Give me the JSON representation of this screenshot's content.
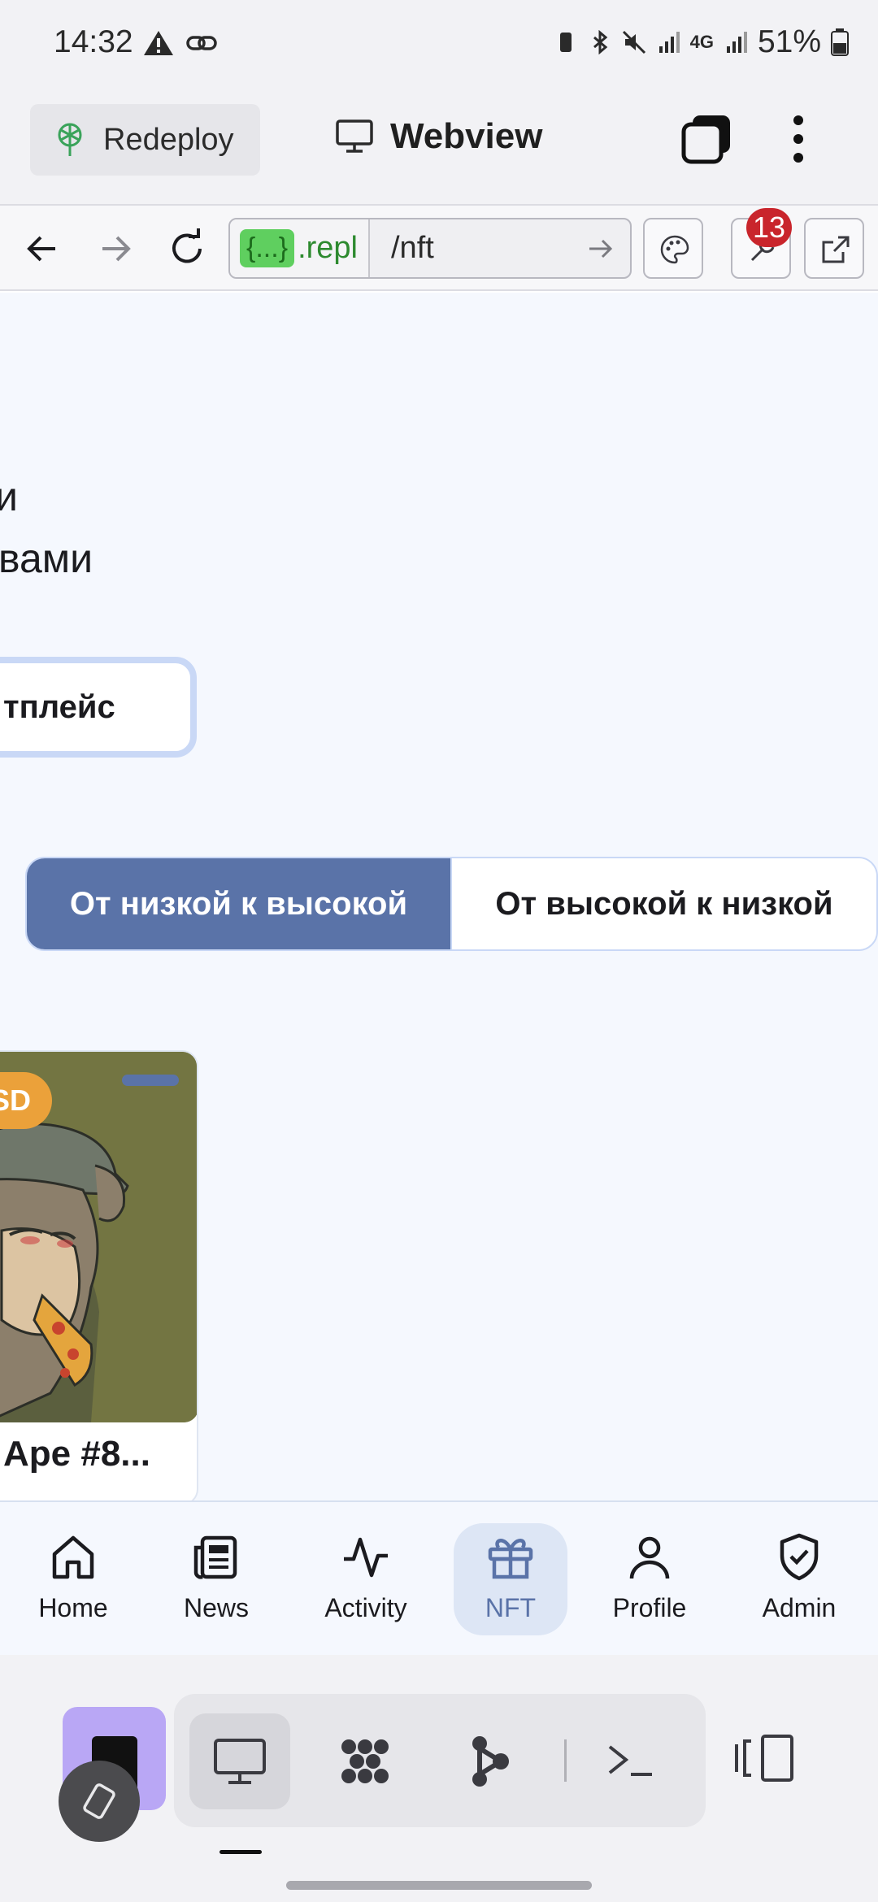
{
  "status_bar": {
    "time": "14:32",
    "battery": "51%",
    "network": "4G"
  },
  "app_bar": {
    "redeploy_label": "Redeploy",
    "title": "Webview"
  },
  "browser": {
    "url_host_badge": "{...}",
    "url_host": ".repl",
    "url_path": "/nft",
    "notification_count": "13"
  },
  "page": {
    "hero_line1": "и",
    "hero_line2": "вами",
    "marketplace_button": "тплейс",
    "sort_options": {
      "low_to_high": "От низкой к высокой",
      "high_to_low": "От высокой к низкой"
    },
    "nft_cards": [
      {
        "price_badge": "SD",
        "name": "Ape #8..."
      }
    ]
  },
  "bottom_nav": {
    "items": [
      {
        "label": "Home",
        "icon": "home-icon"
      },
      {
        "label": "News",
        "icon": "news-icon"
      },
      {
        "label": "Activity",
        "icon": "activity-icon"
      },
      {
        "label": "NFT",
        "icon": "gift-icon",
        "active": true
      },
      {
        "label": "Profile",
        "icon": "profile-icon"
      },
      {
        "label": "Admin",
        "icon": "shield-check-icon"
      }
    ]
  },
  "colors": {
    "accent": "#5a73a8",
    "page_bg": "#f5f8fe",
    "price_badge": "#eba13a",
    "replit_purple": "#b9a7f5"
  }
}
